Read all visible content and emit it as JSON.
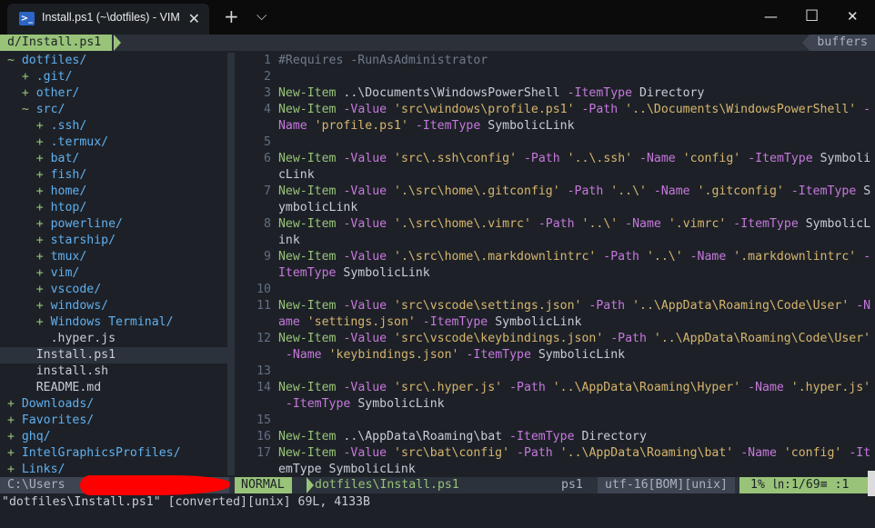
{
  "titlebar": {
    "tab_title": "Install.ps1 (~\\dotfiles) - VIM",
    "tab_icon": "powershell-icon",
    "new_tab": "+",
    "dropdown": "⌵",
    "minimize": "—",
    "maximize": "☐",
    "close": "✕"
  },
  "tabline": {
    "file": "d/Install.ps1",
    "buffers": "buffers"
  },
  "tree": [
    {
      "prefix": "~ ",
      "name": "dotfiles/",
      "kind": "dir",
      "indent": 1
    },
    {
      "prefix": "+ ",
      "name": ".git/",
      "kind": "dir",
      "indent": 3
    },
    {
      "prefix": "+ ",
      "name": "other/",
      "kind": "dir",
      "indent": 3
    },
    {
      "prefix": "~ ",
      "name": "src/",
      "kind": "dir",
      "indent": 3
    },
    {
      "prefix": "+ ",
      "name": ".ssh/",
      "kind": "dir",
      "indent": 5
    },
    {
      "prefix": "+ ",
      "name": ".termux/",
      "kind": "dir",
      "indent": 5
    },
    {
      "prefix": "+ ",
      "name": "bat/",
      "kind": "dir",
      "indent": 5
    },
    {
      "prefix": "+ ",
      "name": "fish/",
      "kind": "dir",
      "indent": 5
    },
    {
      "prefix": "+ ",
      "name": "home/",
      "kind": "dir",
      "indent": 5
    },
    {
      "prefix": "+ ",
      "name": "htop/",
      "kind": "dir",
      "indent": 5
    },
    {
      "prefix": "+ ",
      "name": "powerline/",
      "kind": "dir",
      "indent": 5
    },
    {
      "prefix": "+ ",
      "name": "starship/",
      "kind": "dir",
      "indent": 5
    },
    {
      "prefix": "+ ",
      "name": "tmux/",
      "kind": "dir",
      "indent": 5
    },
    {
      "prefix": "+ ",
      "name": "vim/",
      "kind": "dir",
      "indent": 5
    },
    {
      "prefix": "+ ",
      "name": "vscode/",
      "kind": "dir",
      "indent": 5
    },
    {
      "prefix": "+ ",
      "name": "windows/",
      "kind": "dir",
      "indent": 5
    },
    {
      "prefix": "+ ",
      "name": "Windows Terminal/",
      "kind": "dir",
      "indent": 5
    },
    {
      "prefix": "",
      "name": ".hyper.js",
      "kind": "file",
      "indent": 7
    },
    {
      "prefix": "",
      "name": "Install.ps1",
      "kind": "file",
      "indent": 5,
      "selected": true
    },
    {
      "prefix": "",
      "name": "install.sh",
      "kind": "file",
      "indent": 5
    },
    {
      "prefix": "",
      "name": "README.md",
      "kind": "file",
      "indent": 5
    },
    {
      "prefix": "+ ",
      "name": "Downloads/",
      "kind": "dir",
      "indent": 1
    },
    {
      "prefix": "+ ",
      "name": "Favorites/",
      "kind": "dir",
      "indent": 1
    },
    {
      "prefix": "+ ",
      "name": "ghq/",
      "kind": "dir",
      "indent": 1
    },
    {
      "prefix": "+ ",
      "name": "IntelGraphicsProfiles/",
      "kind": "dir",
      "indent": 1
    },
    {
      "prefix": "+ ",
      "name": "Links/",
      "kind": "dir",
      "indent": 1
    }
  ],
  "code": [
    {
      "ln": "1",
      "parts": [
        [
          "cm",
          "#Requires -RunAsAdministrator"
        ]
      ]
    },
    {
      "ln": "2",
      "parts": []
    },
    {
      "ln": "3",
      "parts": [
        [
          "kw",
          "New-Item"
        ],
        [
          "tx",
          " ..\\Documents\\WindowsPowerShell "
        ],
        [
          "pa",
          "-ItemType"
        ],
        [
          "tx",
          " Directory"
        ]
      ]
    },
    {
      "ln": "4",
      "parts": [
        [
          "kw",
          "New-Item"
        ],
        [
          "tx",
          " "
        ],
        [
          "pa",
          "-Value"
        ],
        [
          "tx",
          " "
        ],
        [
          "st",
          "'src\\windows\\profile.ps1'"
        ],
        [
          "tx",
          " "
        ],
        [
          "pa",
          "-Path"
        ],
        [
          "tx",
          " "
        ],
        [
          "st",
          "'..\\Documents\\WindowsPowerShell'"
        ],
        [
          "tx",
          " "
        ],
        [
          "pa",
          "-"
        ]
      ]
    },
    {
      "ln": "",
      "parts": [
        [
          "pa",
          "Name"
        ],
        [
          "tx",
          " "
        ],
        [
          "st",
          "'profile.ps1'"
        ],
        [
          "tx",
          " "
        ],
        [
          "pa",
          "-ItemType"
        ],
        [
          "tx",
          " SymbolicLink"
        ]
      ]
    },
    {
      "ln": "5",
      "parts": []
    },
    {
      "ln": "6",
      "parts": [
        [
          "kw",
          "New-Item"
        ],
        [
          "tx",
          " "
        ],
        [
          "pa",
          "-Value"
        ],
        [
          "tx",
          " "
        ],
        [
          "st",
          "'src\\.ssh\\config'"
        ],
        [
          "tx",
          " "
        ],
        [
          "pa",
          "-Path"
        ],
        [
          "tx",
          " "
        ],
        [
          "st",
          "'..\\.ssh'"
        ],
        [
          "tx",
          " "
        ],
        [
          "pa",
          "-Name"
        ],
        [
          "tx",
          " "
        ],
        [
          "st",
          "'config'"
        ],
        [
          "tx",
          " "
        ],
        [
          "pa",
          "-ItemType"
        ],
        [
          "tx",
          " Symboli"
        ]
      ]
    },
    {
      "ln": "",
      "parts": [
        [
          "tx",
          "cLink"
        ]
      ]
    },
    {
      "ln": "7",
      "parts": [
        [
          "kw",
          "New-Item"
        ],
        [
          "tx",
          " "
        ],
        [
          "pa",
          "-Value"
        ],
        [
          "tx",
          " "
        ],
        [
          "st",
          "'.\\src\\home\\.gitconfig'"
        ],
        [
          "tx",
          " "
        ],
        [
          "pa",
          "-Path"
        ],
        [
          "tx",
          " "
        ],
        [
          "st",
          "'..\\'"
        ],
        [
          "tx",
          " "
        ],
        [
          "pa",
          "-Name"
        ],
        [
          "tx",
          " "
        ],
        [
          "st",
          "'.gitconfig'"
        ],
        [
          "tx",
          " "
        ],
        [
          "pa",
          "-ItemType"
        ],
        [
          "tx",
          " S"
        ]
      ]
    },
    {
      "ln": "",
      "parts": [
        [
          "tx",
          "ymbolicLink"
        ]
      ]
    },
    {
      "ln": "8",
      "parts": [
        [
          "kw",
          "New-Item"
        ],
        [
          "tx",
          " "
        ],
        [
          "pa",
          "-Value"
        ],
        [
          "tx",
          " "
        ],
        [
          "st",
          "'.\\src\\home\\.vimrc'"
        ],
        [
          "tx",
          " "
        ],
        [
          "pa",
          "-Path"
        ],
        [
          "tx",
          " "
        ],
        [
          "st",
          "'..\\'"
        ],
        [
          "tx",
          " "
        ],
        [
          "pa",
          "-Name"
        ],
        [
          "tx",
          " "
        ],
        [
          "st",
          "'.vimrc'"
        ],
        [
          "tx",
          " "
        ],
        [
          "pa",
          "-ItemType"
        ],
        [
          "tx",
          " SymbolicL"
        ]
      ]
    },
    {
      "ln": "",
      "parts": [
        [
          "tx",
          "ink"
        ]
      ]
    },
    {
      "ln": "9",
      "parts": [
        [
          "kw",
          "New-Item"
        ],
        [
          "tx",
          " "
        ],
        [
          "pa",
          "-Value"
        ],
        [
          "tx",
          " "
        ],
        [
          "st",
          "'.\\src\\home\\.markdownlintrc'"
        ],
        [
          "tx",
          " "
        ],
        [
          "pa",
          "-Path"
        ],
        [
          "tx",
          " "
        ],
        [
          "st",
          "'..\\'"
        ],
        [
          "tx",
          " "
        ],
        [
          "pa",
          "-Name"
        ],
        [
          "tx",
          " "
        ],
        [
          "st",
          "'.markdownlintrc'"
        ],
        [
          "tx",
          " "
        ],
        [
          "pa",
          "-"
        ]
      ]
    },
    {
      "ln": "",
      "parts": [
        [
          "pa",
          "ItemType"
        ],
        [
          "tx",
          " SymbolicLink"
        ]
      ]
    },
    {
      "ln": "10",
      "parts": []
    },
    {
      "ln": "11",
      "parts": [
        [
          "kw",
          "New-Item"
        ],
        [
          "tx",
          " "
        ],
        [
          "pa",
          "-Value"
        ],
        [
          "tx",
          " "
        ],
        [
          "st",
          "'src\\vscode\\settings.json'"
        ],
        [
          "tx",
          " "
        ],
        [
          "pa",
          "-Path"
        ],
        [
          "tx",
          " "
        ],
        [
          "st",
          "'..\\AppData\\Roaming\\Code\\User'"
        ],
        [
          "tx",
          " "
        ],
        [
          "pa",
          "-N"
        ]
      ]
    },
    {
      "ln": "",
      "parts": [
        [
          "pa",
          "ame"
        ],
        [
          "tx",
          " "
        ],
        [
          "st",
          "'settings.json'"
        ],
        [
          "tx",
          " "
        ],
        [
          "pa",
          "-ItemType"
        ],
        [
          "tx",
          " SymbolicLink"
        ]
      ]
    },
    {
      "ln": "12",
      "parts": [
        [
          "kw",
          "New-Item"
        ],
        [
          "tx",
          " "
        ],
        [
          "pa",
          "-Value"
        ],
        [
          "tx",
          " "
        ],
        [
          "st",
          "'src\\vscode\\keybindings.json'"
        ],
        [
          "tx",
          " "
        ],
        [
          "pa",
          "-Path"
        ],
        [
          "tx",
          " "
        ],
        [
          "st",
          "'..\\AppData\\Roaming\\Code\\User'"
        ]
      ]
    },
    {
      "ln": "",
      "parts": [
        [
          "tx",
          " "
        ],
        [
          "pa",
          "-Name"
        ],
        [
          "tx",
          " "
        ],
        [
          "st",
          "'keybindings.json'"
        ],
        [
          "tx",
          " "
        ],
        [
          "pa",
          "-ItemType"
        ],
        [
          "tx",
          " SymbolicLink"
        ]
      ]
    },
    {
      "ln": "13",
      "parts": []
    },
    {
      "ln": "14",
      "parts": [
        [
          "kw",
          "New-Item"
        ],
        [
          "tx",
          " "
        ],
        [
          "pa",
          "-Value"
        ],
        [
          "tx",
          " "
        ],
        [
          "st",
          "'src\\.hyper.js'"
        ],
        [
          "tx",
          " "
        ],
        [
          "pa",
          "-Path"
        ],
        [
          "tx",
          " "
        ],
        [
          "st",
          "'..\\AppData\\Roaming\\Hyper'"
        ],
        [
          "tx",
          " "
        ],
        [
          "pa",
          "-Name"
        ],
        [
          "tx",
          " "
        ],
        [
          "st",
          "'.hyper.js'"
        ]
      ]
    },
    {
      "ln": "",
      "parts": [
        [
          "tx",
          " "
        ],
        [
          "pa",
          "-ItemType"
        ],
        [
          "tx",
          " SymbolicLink"
        ]
      ]
    },
    {
      "ln": "15",
      "parts": []
    },
    {
      "ln": "16",
      "parts": [
        [
          "kw",
          "New-Item"
        ],
        [
          "tx",
          " ..\\AppData\\Roaming\\bat "
        ],
        [
          "pa",
          "-ItemType"
        ],
        [
          "tx",
          " Directory"
        ]
      ]
    },
    {
      "ln": "17",
      "parts": [
        [
          "kw",
          "New-Item"
        ],
        [
          "tx",
          " "
        ],
        [
          "pa",
          "-Value"
        ],
        [
          "tx",
          " "
        ],
        [
          "st",
          "'src\\bat\\config'"
        ],
        [
          "tx",
          " "
        ],
        [
          "pa",
          "-Path"
        ],
        [
          "tx",
          " "
        ],
        [
          "st",
          "'..\\AppData\\Roaming\\bat'"
        ],
        [
          "tx",
          " "
        ],
        [
          "pa",
          "-Name"
        ],
        [
          "tx",
          " "
        ],
        [
          "st",
          "'config'"
        ],
        [
          "tx",
          " "
        ],
        [
          "pa",
          "-It"
        ]
      ]
    },
    {
      "ln": "",
      "parts": [
        [
          "tx",
          "emType SymbolicLink"
        ]
      ]
    }
  ],
  "statusline": {
    "tree_path": "C:\\Users",
    "mode": "NORMAL",
    "file": "dotfiles\\Install.ps1",
    "filetype": "ps1",
    "encoding": "utf-16[BOM][unix]",
    "position": "1% ㏑:1/69≡  :1"
  },
  "cmdline": "\"dotfiles\\Install.ps1\" [converted][unix] 69L, 4133B",
  "colors": {
    "accent": "#98c379",
    "keyword": "#98c379",
    "param": "#c678dd",
    "string": "#d7b56d",
    "directory": "#61afef"
  }
}
